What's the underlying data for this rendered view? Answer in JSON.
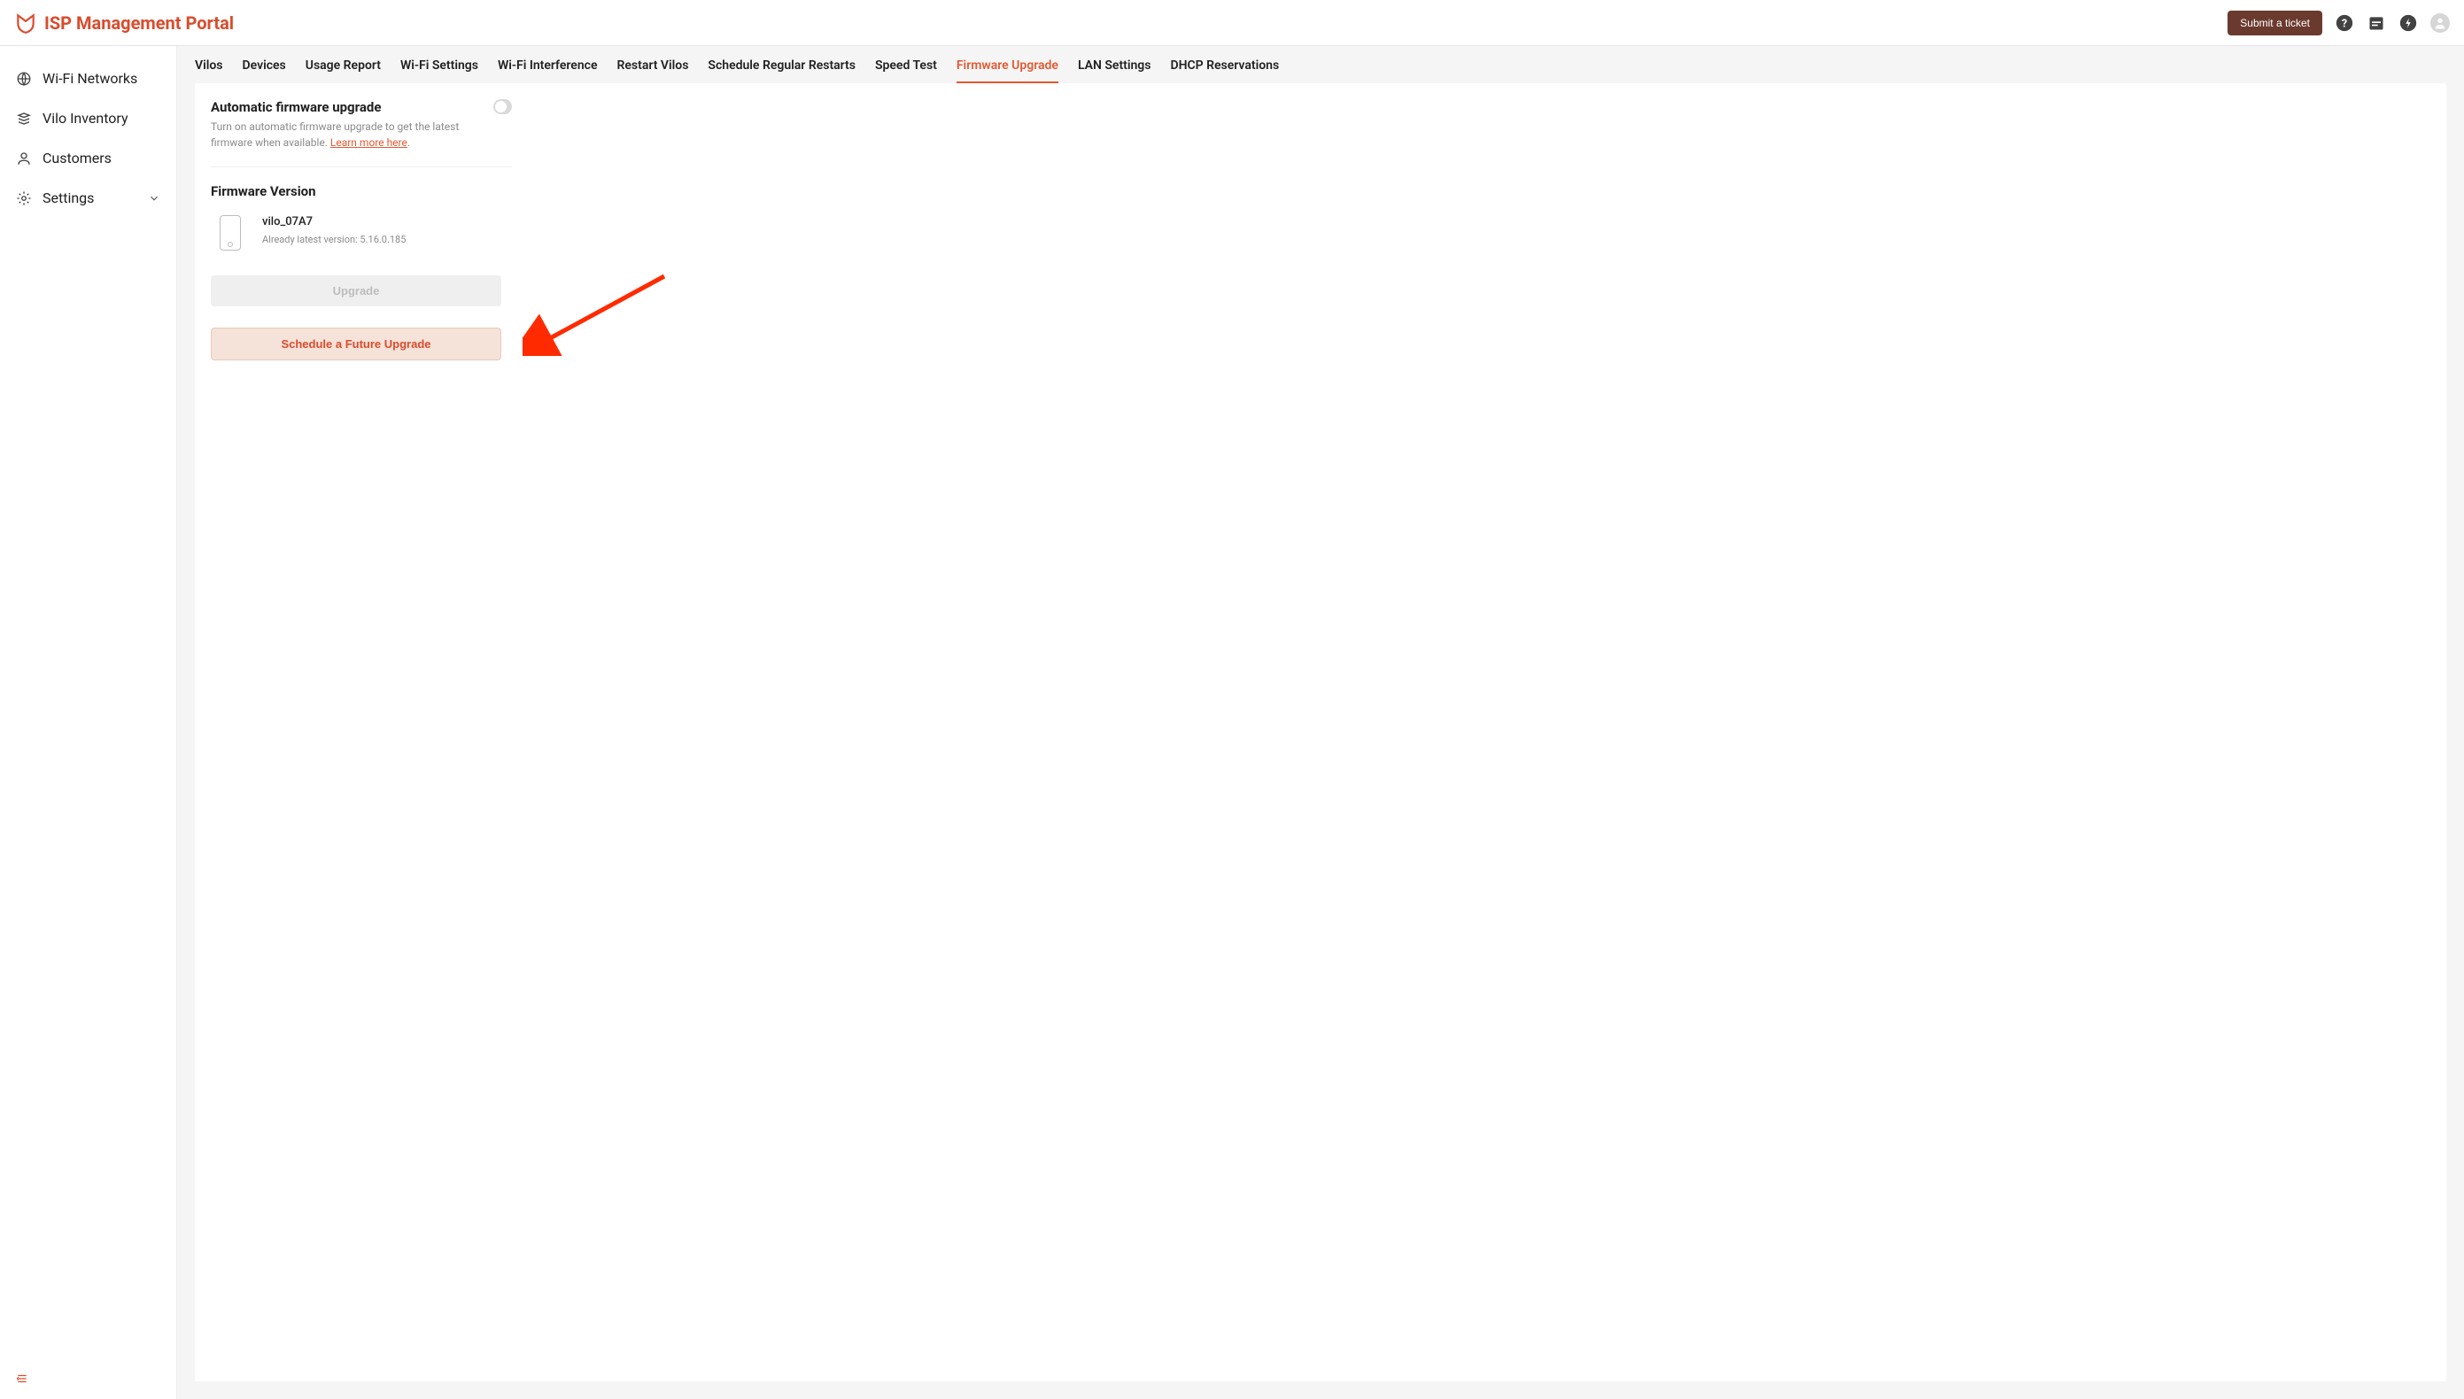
{
  "header": {
    "title": "ISP Management Portal",
    "submit_ticket_label": "Submit a ticket"
  },
  "sidebar": {
    "items": [
      {
        "label": "Wi-Fi Networks",
        "icon": "globe"
      },
      {
        "label": "Vilo Inventory",
        "icon": "stack"
      },
      {
        "label": "Customers",
        "icon": "person"
      },
      {
        "label": "Settings",
        "icon": "gear",
        "expandable": true
      }
    ]
  },
  "tabs": [
    "Vilos",
    "Devices",
    "Usage Report",
    "Wi-Fi Settings",
    "Wi-Fi Interference",
    "Restart Vilos",
    "Schedule Regular Restarts",
    "Speed Test",
    "Firmware Upgrade",
    "LAN Settings",
    "DHCP Reservations"
  ],
  "active_tab": "Firmware Upgrade",
  "auto_upgrade": {
    "title": "Automatic firmware upgrade",
    "description_prefix": "Turn on automatic firmware upgrade to get the latest firmware when available. ",
    "link_text": "Learn more here",
    "enabled": false
  },
  "firmware_version": {
    "title": "Firmware Version",
    "device_name": "vilo_07A7",
    "status": "Already latest version: 5.16.0.185"
  },
  "upgrade_button_label": "Upgrade",
  "schedule_button_label": "Schedule a Future Upgrade"
}
